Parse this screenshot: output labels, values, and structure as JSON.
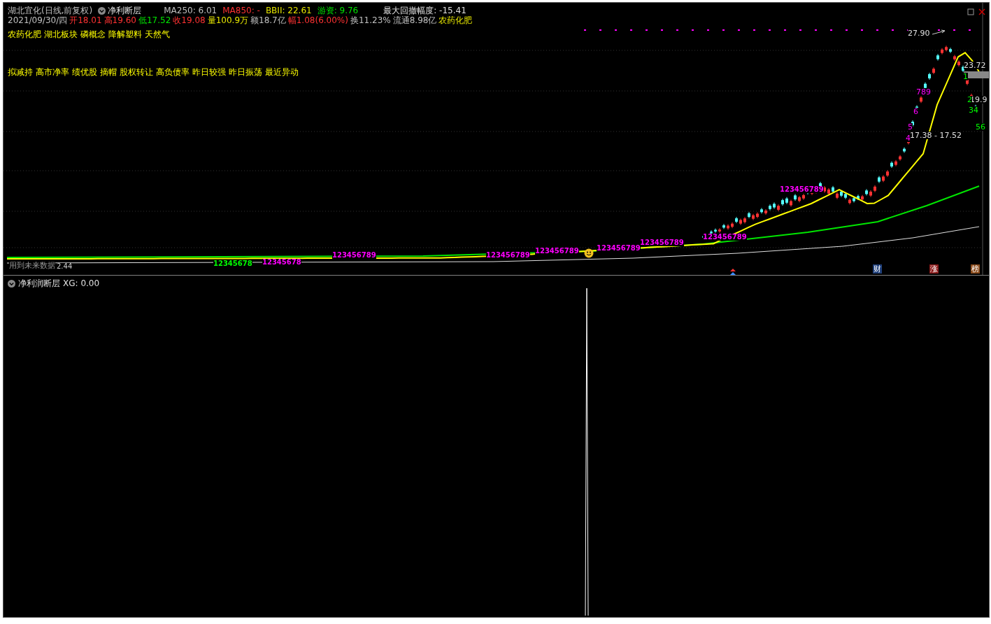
{
  "main_panel": {
    "title": "湖北宜化(日线,前复权)",
    "indicator": "净利断层",
    "indicator_values": [
      {
        "text": "MA250: 6.01",
        "color": "#c0c0c0"
      },
      {
        "text": "MA850: -",
        "color": "#ff3232"
      },
      {
        "text": "BBII: 22.61",
        "color": "#e6e600"
      },
      {
        "text": "游资: 9.76",
        "color": "#00e600"
      }
    ],
    "drawdown": "最大回撤幅度: -15.41",
    "quote": [
      {
        "text": "2021/09/30/四",
        "color": "#c0c0c0"
      },
      {
        "text": "开18.01",
        "color": "#ff3232"
      },
      {
        "text": "高19.60",
        "color": "#ff3232"
      },
      {
        "text": "低17.52",
        "color": "#00e600"
      },
      {
        "text": "收19.08",
        "color": "#ff3232"
      },
      {
        "text": "量100.9万",
        "color": "#e6e600"
      },
      {
        "text": "额18.7亿",
        "color": "#c0c0c0"
      },
      {
        "text": "幅1.08(6.00%)",
        "color": "#ff3232"
      },
      {
        "text": "换11.23%",
        "color": "#c0c0c0"
      },
      {
        "text": "流通8.98亿",
        "color": "#c0c0c0"
      },
      {
        "text": "农药化肥",
        "color": "#e6e600"
      }
    ],
    "concepts": [
      "农药化肥",
      "湖北板块",
      "磷概念",
      "降解塑料",
      "天然气"
    ],
    "signals": [
      "拟减持",
      "高市净率",
      "绩优股",
      "摘帽",
      "股权转让",
      "高负债率",
      "昨日较强",
      "昨日振荡",
      "最近异动"
    ],
    "price_labels": [
      "27.90",
      "23.72",
      "19.9",
      "17.38 - 17.52"
    ],
    "future_warning": "用到未来数据",
    "future_value": "2.44",
    "sequence_labels": [
      {
        "text": "12345678",
        "color": "#00ff00"
      },
      {
        "text": "12345678",
        "color": "#ff00ff"
      },
      {
        "text": "123456789",
        "color": "#ff00ff"
      },
      {
        "text": "123456789",
        "color": "#ff00ff"
      },
      {
        "text": "123456789",
        "color": "#ff00ff"
      },
      {
        "text": "123456789",
        "color": "#ff00ff"
      },
      {
        "text": "123456789",
        "color": "#ff00ff"
      },
      {
        "text": "123456789",
        "color": "#ff00ff"
      },
      {
        "text": "123456789",
        "color": "#ff00ff"
      }
    ],
    "wave_marks": [
      {
        "text": "4",
        "color": "#ff00ff"
      },
      {
        "text": "5",
        "color": "#ff00ff"
      },
      {
        "text": "6",
        "color": "#ff00ff"
      },
      {
        "text": "789",
        "color": "#ff00ff"
      },
      {
        "text": "1",
        "color": "#00ff00"
      },
      {
        "text": "2",
        "color": "#00ff00"
      },
      {
        "text": "34",
        "color": "#00ff00"
      },
      {
        "text": "56",
        "color": "#00ff00"
      }
    ],
    "badges": [
      {
        "text": "财",
        "color": "#1f3f7a"
      },
      {
        "text": "涨",
        "color": "#8a1a1a"
      },
      {
        "text": "榜",
        "color": "#8a4a1a"
      }
    ]
  },
  "sub_panel": {
    "indicator": "净利润断层",
    "value": "XG: 0.00"
  }
}
